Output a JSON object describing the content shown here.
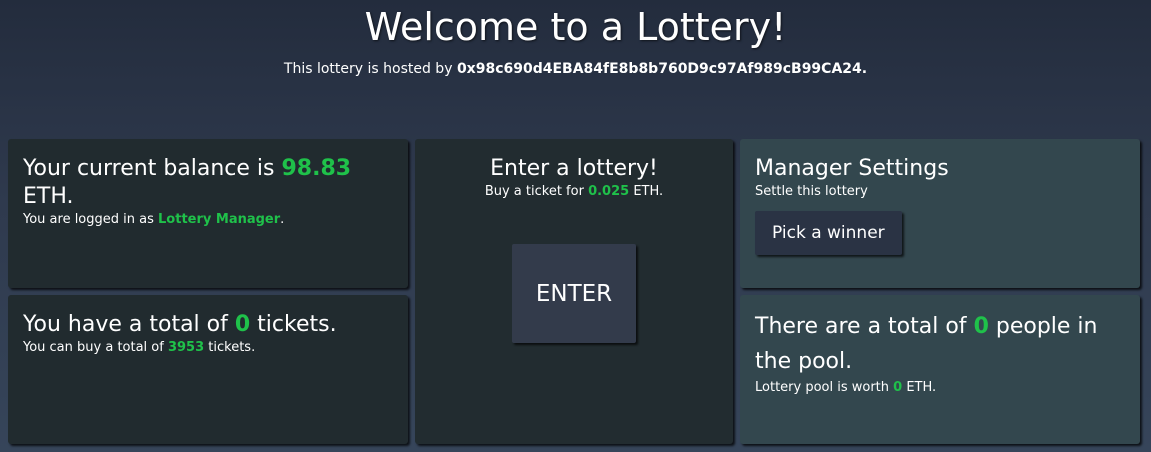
{
  "header": {
    "title": "Welcome to a Lottery!",
    "hosted_prefix": "This lottery is hosted by ",
    "host_address": "0x98c690d4EBA84fE8b8b760D9c97Af989cB99CA24."
  },
  "balance_card": {
    "title_prefix": "Your current balance is ",
    "balance": "98.83",
    "title_suffix": " ETH.",
    "login_prefix": "You are logged in as ",
    "role": "Lottery Manager",
    "login_suffix": "."
  },
  "tickets_card": {
    "title_prefix": "You have a total of ",
    "tickets": "0",
    "title_suffix": " tickets.",
    "buy_prefix": "You can buy a total of ",
    "buyable": "3953",
    "buy_suffix": " tickets."
  },
  "enter_card": {
    "title": "Enter a lottery!",
    "price_prefix": "Buy a ticket for ",
    "price": "0.025",
    "price_suffix": " ETH.",
    "button_label": "ENTER"
  },
  "manager_card": {
    "title": "Manager Settings",
    "subtitle": "Settle this lottery",
    "button_label": "Pick a winner"
  },
  "pool_card": {
    "title_prefix": "There are a total of ",
    "people": "0",
    "title_suffix": " people in the pool.",
    "worth_prefix": "Lottery pool is worth ",
    "worth": "0",
    "worth_suffix": " ETH."
  },
  "colors": {
    "accent_green": "#1fc14a",
    "card_dark": "#212b2f",
    "card_light": "#33474e",
    "button": "#333b4b"
  }
}
